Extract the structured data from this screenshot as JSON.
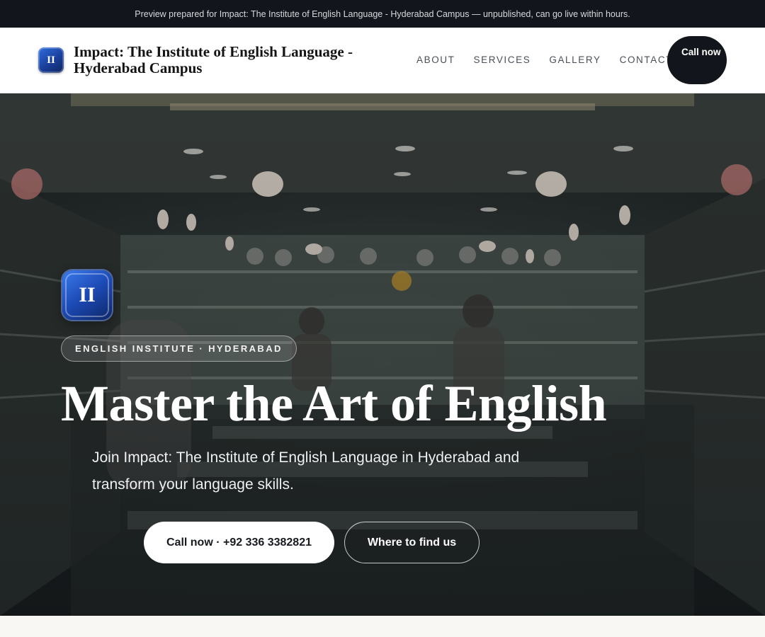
{
  "preview_bar": {
    "text": "Preview prepared for Impact: The Institute of English Language - Hyderabad Campus — unpublished, can go live within hours."
  },
  "header": {
    "logo_text": "II",
    "brand_name": "Impact: The Institute of English Language - Hyderabad Campus",
    "nav": [
      "ABOUT",
      "SERVICES",
      "GALLERY",
      "CONTACT"
    ],
    "call_button": "Call now"
  },
  "hero": {
    "logo_text": "II",
    "eyebrow": "ENGLISH INSTITUTE · HYDERABAD",
    "title": "Master the Art of English",
    "subtitle": "Join Impact: The Institute of English Language in Hyderabad and transform your language skills.",
    "cta_primary": "Call now · +92 336 3382821",
    "cta_secondary": "Where to find us"
  },
  "colors": {
    "dark": "#12151b",
    "brand_blue": "#1c49b3",
    "page_bg": "#f8f7f3"
  },
  "icons": {
    "brand": "institute-monogram-icon"
  }
}
